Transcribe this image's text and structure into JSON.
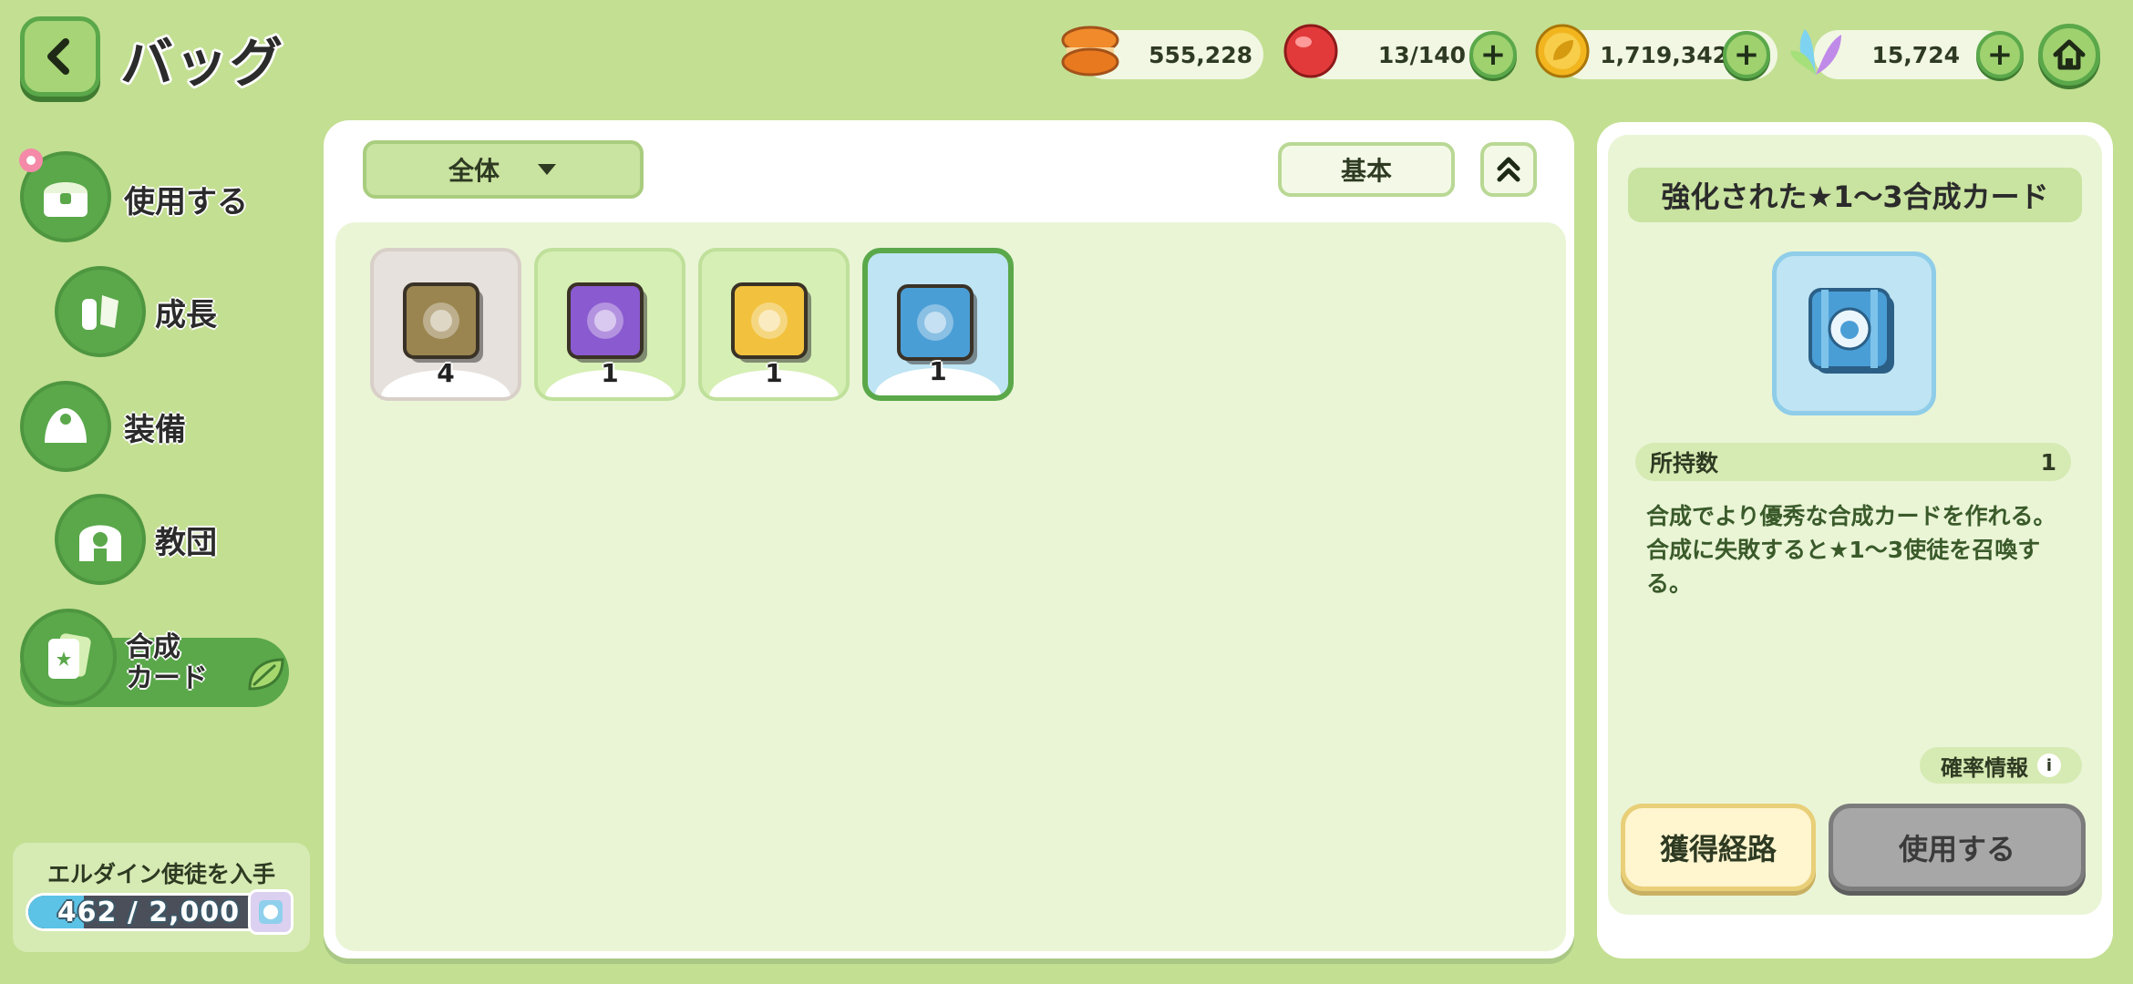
{
  "header": {
    "title": "バッグ",
    "resources": [
      {
        "name": "bread",
        "icon": "macaron-icon",
        "value": "555,228",
        "has_plus": false
      },
      {
        "name": "stamina",
        "icon": "red-candy-icon",
        "value": "13/140",
        "has_plus": true
      },
      {
        "name": "gold",
        "icon": "leaf-coin-icon",
        "value": "1,719,342",
        "has_plus": true
      },
      {
        "name": "crystal",
        "icon": "rainbow-leaf-icon",
        "value": "15,724",
        "has_plus": true
      }
    ],
    "plus_label": "+"
  },
  "sidebar": {
    "items": [
      {
        "label": "使用する",
        "icon": "chest-icon"
      },
      {
        "label": "成長",
        "icon": "potion-crystal-icon"
      },
      {
        "label": "装備",
        "icon": "hat-icon"
      },
      {
        "label": "教団",
        "icon": "temple-icon"
      },
      {
        "label": "合成\nカード",
        "label_line1": "合成",
        "label_line2": "カード",
        "icon": "card-icon",
        "active": true
      }
    ],
    "quest": {
      "title": "エルダイン使徒を入手",
      "progress_text": "462 / 2,000",
      "current": 462,
      "total": 2000
    }
  },
  "main": {
    "filter_label": "全体",
    "sort_label": "基本",
    "items": [
      {
        "name": "bronze-card",
        "count": "4",
        "color": "#9a8550",
        "bg": "#e6e1dc",
        "border": "#d8d0c8",
        "selected": false
      },
      {
        "name": "purple-card",
        "count": "1",
        "color": "#8a5ad0",
        "bg": "#d6efb4",
        "border": "#bfe09a",
        "selected": false
      },
      {
        "name": "gold-card",
        "count": "1",
        "color": "#f2c23e",
        "bg": "#d6efb4",
        "border": "#bfe09a",
        "selected": false
      },
      {
        "name": "blue-card",
        "count": "1",
        "color": "#4a9ed6",
        "bg": "#bfe4f3",
        "border": "#5aa84a",
        "selected": true
      }
    ]
  },
  "detail": {
    "title": "強化された★1～3合成カード",
    "qty_label": "所持数",
    "qty_value": "1",
    "desc_line1": "合成でより優秀な合成カードを作れる。",
    "desc_line2": "合成に失敗すると★1～3使徒を召喚する。",
    "prob_label": "確率情報",
    "obtain_label": "獲得経路",
    "use_label": "使用する"
  },
  "colors": {
    "background": "#c3df92",
    "accent_green": "#5aa84a",
    "selected_border": "#5aa84a",
    "use_button_disabled": "#a7a7a7"
  }
}
